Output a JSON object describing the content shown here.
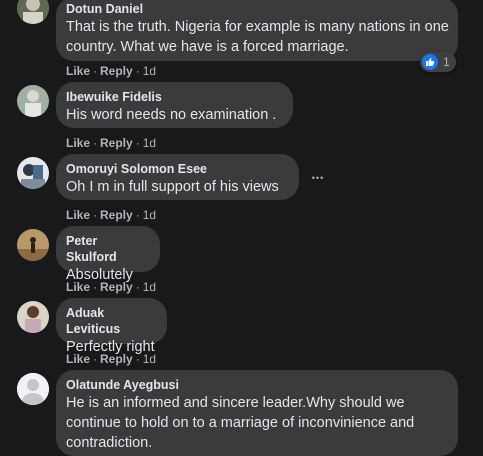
{
  "comments": [
    {
      "author": "Dotun Daniel",
      "text": "That is the truth. Nigeria for example is many nations in one country. What we have is a forced marriage.",
      "like": "Like",
      "reply": "Reply",
      "time": "1d",
      "reaction_count": "1"
    },
    {
      "author": "Ibewuike Fidelis",
      "text": "His word needs no examination .",
      "like": "Like",
      "reply": "Reply",
      "time": "1d"
    },
    {
      "author": "Omoruyi Solomon Esee",
      "text": "Oh I m in full support of his views",
      "like": "Like",
      "reply": "Reply",
      "time": "1d"
    },
    {
      "author": "Peter Skulford",
      "text": "Absolutely",
      "like": "Like",
      "reply": "Reply",
      "time": "1d"
    },
    {
      "author": "Aduak Leviticus",
      "text": "Perfectly right",
      "like": "Like",
      "reply": "Reply",
      "time": "1d"
    },
    {
      "author": "Olatunde Ayegbusi",
      "text": "He is an informed and sincere leader.Why should we continue to hold on to a marriage of inconvinience and contradiction."
    }
  ],
  "separator": "·",
  "more_glyph": "•••",
  "colors": {
    "background": "#18191a",
    "bubble": "#3a3b3c",
    "text": "#e4e6eb",
    "secondary": "#b0b3b8",
    "like_blue": "#1877f2"
  }
}
